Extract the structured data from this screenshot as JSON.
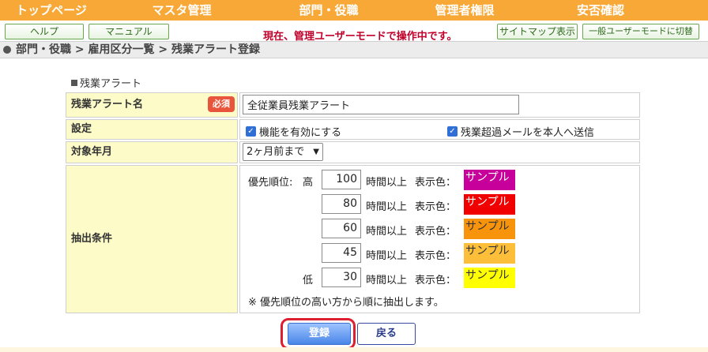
{
  "nav": {
    "top": "トップページ",
    "master": "マスタ管理",
    "dept": "部門・役職",
    "admin": "管理者権限",
    "safety": "安否確認"
  },
  "toolbar": {
    "help": "ヘルプ",
    "manual": "マニュアル",
    "mode_message": "現在、管理ユーザーモードで操作中です。",
    "sitemap": "サイトマップ表示",
    "user_mode": "一般ユーザーモードに切替"
  },
  "breadcrumb": "部門・役職 > 雇用区分一覧 > 残業アラート登録",
  "section_title": "残業アラート",
  "form": {
    "name_label": "残業アラート名",
    "required_badge": "必須",
    "name_value": "全従業員残業アラート",
    "settings_label": "設定",
    "enable_label": "機能を有効にする",
    "mail_label": "残業超過メールを本人へ送信",
    "period_label": "対象年月",
    "period_value": "2ヶ月前まで",
    "conditions_label": "抽出条件",
    "priority_label": "優先順位:",
    "high": "高",
    "low": "低",
    "hours_suffix": "時間以上",
    "color_label": "表示色：",
    "sample": "サンプル",
    "thresholds": [
      "100",
      "80",
      "60",
      "45",
      "30"
    ],
    "colors": [
      "#c8009b",
      "#f00000",
      "#f7940c",
      "#fdbf3a",
      "#ffff00"
    ],
    "note": "※ 優先順位の高い方から順に抽出します。"
  },
  "buttons": {
    "register": "登録",
    "back": "戻る"
  }
}
